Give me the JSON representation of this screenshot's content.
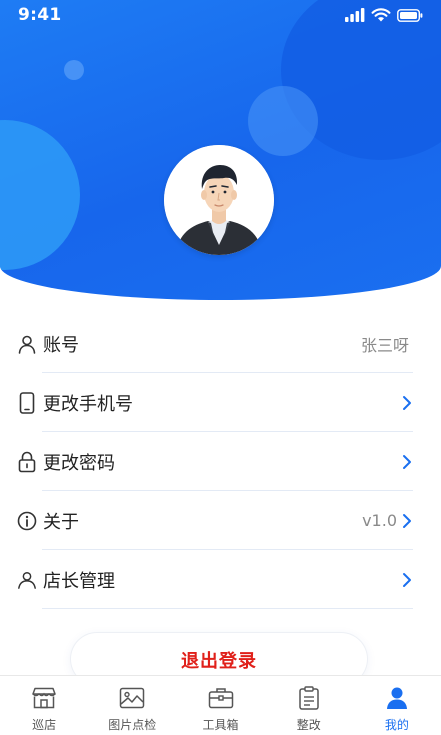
{
  "status_bar": {
    "time": "9:41"
  },
  "profile": {
    "avatar_icon": "user-avatar"
  },
  "menu": {
    "items": [
      {
        "label": "账号",
        "value": "张三呀",
        "icon": "user-icon",
        "has_chevron": false
      },
      {
        "label": "更改手机号",
        "value": "",
        "icon": "phone-icon",
        "has_chevron": true
      },
      {
        "label": "更改密码",
        "value": "",
        "icon": "lock-icon",
        "has_chevron": true
      },
      {
        "label": "关于",
        "value": "v1.0",
        "icon": "info-icon",
        "has_chevron": true
      },
      {
        "label": "店长管理",
        "value": "",
        "icon": "manager-icon",
        "has_chevron": true
      }
    ]
  },
  "logout": {
    "label": "退出登录"
  },
  "tabbar": {
    "active": 4,
    "tabs": [
      {
        "label": "巡店",
        "icon": "store-icon"
      },
      {
        "label": "图片点检",
        "icon": "image-icon"
      },
      {
        "label": "工具箱",
        "icon": "toolbox-icon"
      },
      {
        "label": "整改",
        "icon": "clipboard-icon"
      },
      {
        "label": "我的",
        "icon": "person-icon"
      }
    ]
  },
  "colors": {
    "primary": "#1a6ff0",
    "danger": "#e0201a",
    "text": "#222222",
    "muted": "#8a8a8a"
  }
}
